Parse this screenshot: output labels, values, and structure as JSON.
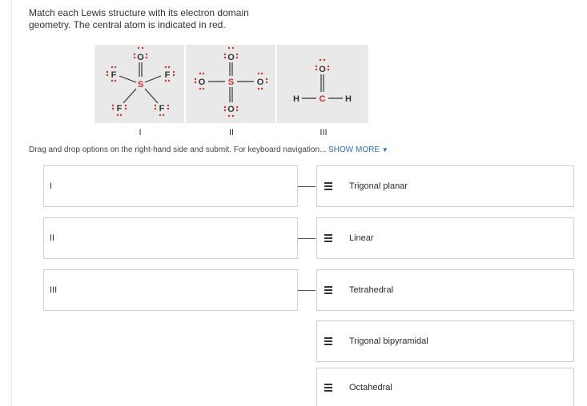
{
  "question": {
    "line1": "Match each Lewis structure with its electron domain",
    "line2": "geometry. The central atom is indicated in red."
  },
  "structures": [
    {
      "roman": "I",
      "atoms": {
        "O": "O",
        "S": "S",
        "F": "F"
      }
    },
    {
      "roman": "II",
      "atoms": {
        "O": "O",
        "S": "S"
      }
    },
    {
      "roman": "III",
      "atoms": {
        "O": "O",
        "C": "C",
        "H": "H"
      }
    }
  ],
  "colors": {
    "central_atom": "#d22d2d",
    "lone_pair": "#d22d2d",
    "link": "#2a6ebb",
    "panel_bg": "#e9e9e9"
  },
  "instructions": {
    "text": "Drag and drop options on the right-hand side and submit. For keyboard navigation...",
    "show_more": "SHOW MORE",
    "show_more_icon": "chevron-down-icon"
  },
  "targets": [
    {
      "label": "I"
    },
    {
      "label": "II"
    },
    {
      "label": "III"
    }
  ],
  "options": [
    {
      "label": "Trigonal planar",
      "icon": "drag-handle-icon"
    },
    {
      "label": "Linear",
      "icon": "drag-handle-icon"
    },
    {
      "label": "Tetrahedral",
      "icon": "drag-handle-icon"
    },
    {
      "label": "Trigonal bipyramidal",
      "icon": "drag-handle-icon"
    },
    {
      "label": "Octahedral",
      "icon": "drag-handle-icon"
    }
  ]
}
